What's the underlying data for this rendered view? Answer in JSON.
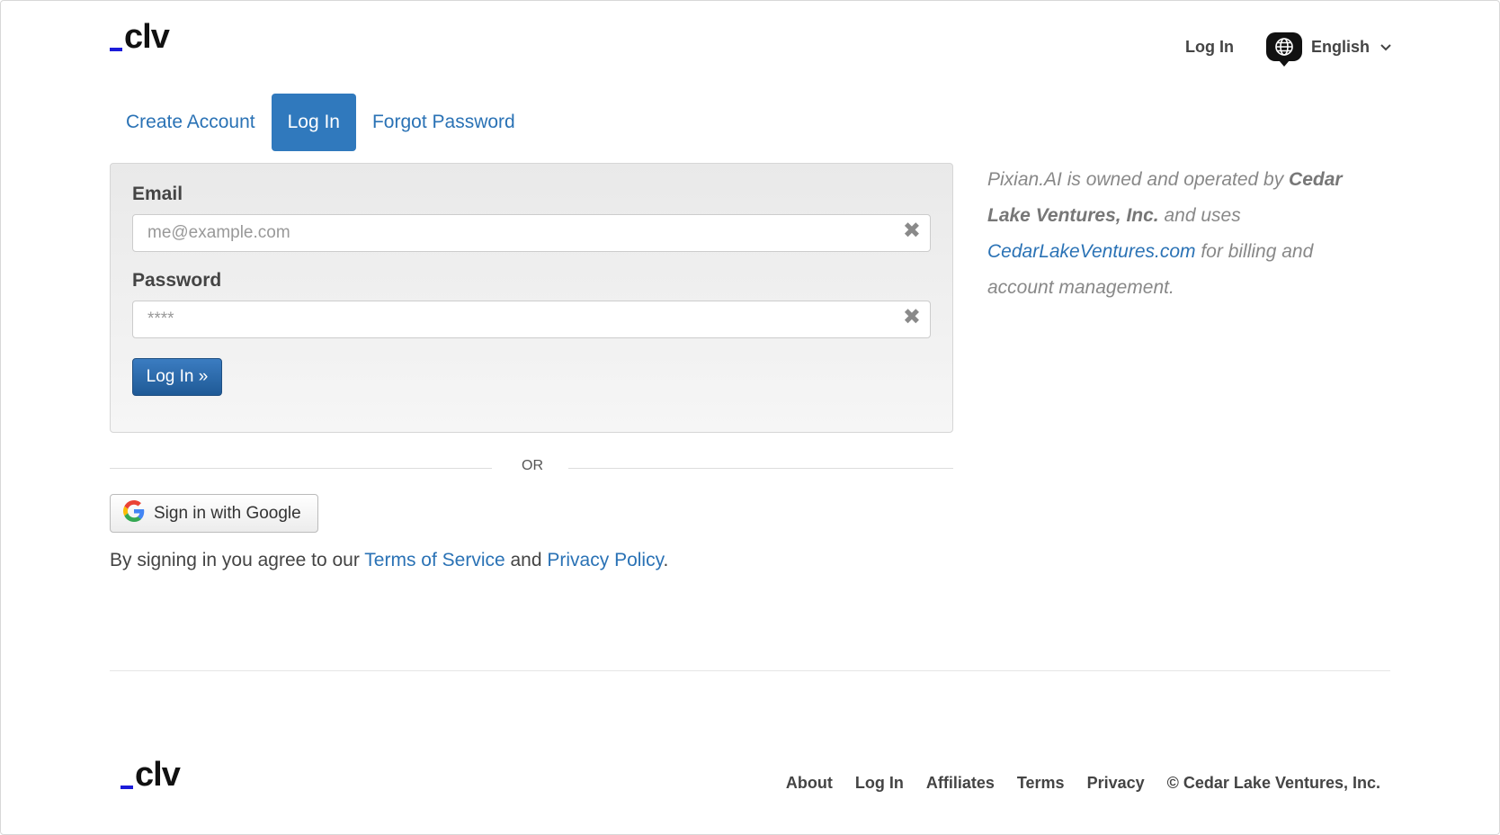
{
  "header": {
    "logo_text": "clv",
    "nav_login": "Log In",
    "language": "English"
  },
  "tabs": [
    {
      "label": "Create Account"
    },
    {
      "label": "Log In"
    },
    {
      "label": "Forgot Password"
    }
  ],
  "form": {
    "email_label": "Email",
    "email_placeholder": "me@example.com",
    "email_value": "",
    "password_label": "Password",
    "password_placeholder": "****",
    "password_value": "",
    "submit_label": "Log In »"
  },
  "divider_text": "OR",
  "google_button": "Sign in with Google",
  "agreement": {
    "prefix": "By signing in you agree to our ",
    "terms": "Terms of Service",
    "middle": " and ",
    "privacy": "Privacy Policy",
    "suffix": "."
  },
  "side_note": {
    "part1": "Pixian.AI is owned and operated by ",
    "company": "Cedar Lake Ventures, Inc.",
    "part2": " and uses ",
    "link": "CedarLakeVentures.com",
    "part3": " for billing and account management."
  },
  "footer": {
    "logo_text": "clv",
    "links": [
      "About",
      "Log In",
      "Affiliates",
      "Terms",
      "Privacy"
    ],
    "copyright": "© Cedar Lake Ventures, Inc."
  },
  "colors": {
    "accent": "#3079bd",
    "link": "#2a72b5",
    "logo_dash": "#1c1cd9"
  }
}
